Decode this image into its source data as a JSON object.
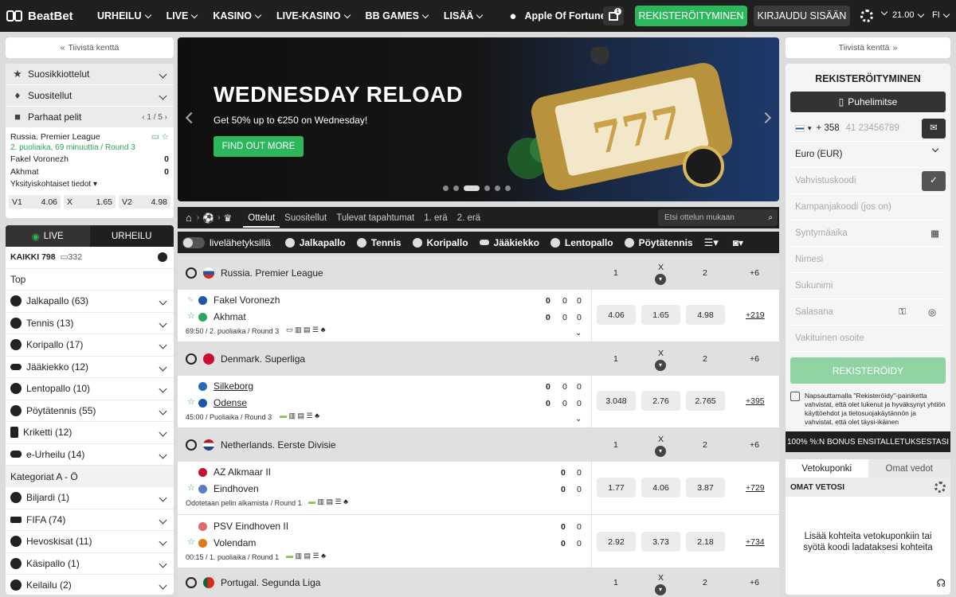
{
  "header": {
    "brand": "BeatBet",
    "nav": [
      "URHEILU",
      "LIVE",
      "KASINO",
      "LIVE-KASINO",
      "BB GAMES",
      "LISÄÄ"
    ],
    "apple_game": "Apple Of Fortune",
    "gift_count": "1",
    "register": "REKISTERÖITYMINEN",
    "login": "KIRJAUDU SISÄÄN",
    "time": "21.00",
    "lang": "FI"
  },
  "left": {
    "collapse": "Tiivistä kenttä",
    "favorites": "Suosikkiottelut",
    "recommended": "Suositellut",
    "best_games": "Parhaat pelit",
    "best_pager": "1 / 5",
    "best_match": {
      "league": "Russia. Premier League",
      "status": "2. puoliaika, 69 minuuttia / Round 3",
      "home": "Fakel Voronezh",
      "home_score": "0",
      "away": "Akhmat",
      "away_score": "0",
      "details": "Yksityiskohtaiset tiedot",
      "odds": [
        {
          "l": "V1",
          "v": "4.06"
        },
        {
          "l": "X",
          "v": "1.65"
        },
        {
          "l": "V2",
          "v": "4.98"
        }
      ]
    },
    "tab_live": "LIVE",
    "tab_sport": "URHEILU",
    "all_label": "KAIKKI 798",
    "all_stream": "332",
    "top": "Top",
    "sports": [
      "Jalkapallo (63)",
      "Tennis (13)",
      "Koripallo (17)",
      "Jääkiekko (12)",
      "Lentopallo (10)",
      "Pöytätennis (55)",
      "Kriketti (12)",
      "e-Urheilu (14)"
    ],
    "categories": "Kategoriat A - Ö",
    "cats": [
      "Biljardi (1)",
      "FIFA (74)",
      "Hevoskisat (11)",
      "Käsipallo (1)",
      "Keilailu (2)"
    ]
  },
  "banner": {
    "title": "WEDNESDAY RELOAD",
    "subtitle": "Get 50% up to €250 on Wednesday!",
    "cta": "FIND OUT MORE"
  },
  "main": {
    "tabs": [
      "Ottelut",
      "Suositellut",
      "Tulevat tapahtumat",
      "1. erä",
      "2. erä"
    ],
    "search": "Etsi ottelun mukaan",
    "live_toggle": "livelähetyksillä",
    "filters": [
      "Jalkapallo",
      "Tennis",
      "Koripallo",
      "Jääkiekko",
      "Lentopallo",
      "Pöytätennis"
    ],
    "leagues": [
      {
        "name": "Russia. Premier League",
        "c1": "1",
        "cx": "X",
        "c2": "2",
        "cp": "+6",
        "flag": "#d52b1e"
      },
      {
        "name": "Denmark. Superliga",
        "c1": "1",
        "cx": "X",
        "c2": "2",
        "cp": "+6",
        "flag": "#c8102e"
      },
      {
        "name": "Netherlands. Eerste Divisie",
        "c1": "1",
        "cx": "X",
        "c2": "2",
        "cp": "+6",
        "flag": "#ae1c28"
      },
      {
        "name": "Portugal. Segunda Liga",
        "c1": "1",
        "cx": "X",
        "c2": "2",
        "cp": "+6",
        "flag": "#046a38"
      }
    ],
    "matches": [
      {
        "home": "Fakel Voronezh",
        "away": "Akhmat",
        "hs": [
          "0",
          "0",
          "0"
        ],
        "as": [
          "0",
          "0",
          "0"
        ],
        "info": "69:50 / 2. puoliaika / Round 3",
        "o1": "4.06",
        "ox": "1.65",
        "o2": "4.98",
        "more": "+219"
      },
      {
        "home": "Silkeborg",
        "away": "Odense",
        "hs": [
          "0",
          "0",
          "0"
        ],
        "as": [
          "0",
          "0",
          "0"
        ],
        "info": "45:00 / Puoliaika / Round 3",
        "o1": "3.048",
        "ox": "2.76",
        "o2": "2.765",
        "more": "+395"
      },
      {
        "home": "AZ Alkmaar II",
        "away": "Eindhoven",
        "hs": [
          "0",
          "0"
        ],
        "as": [
          "0",
          "0"
        ],
        "info": "Odotetaan pelin alkamista / Round 1",
        "o1": "1.77",
        "ox": "4.06",
        "o2": "3.87",
        "more": "+729"
      },
      {
        "home": "PSV Eindhoven II",
        "away": "Volendam",
        "hs": [
          "0",
          "0"
        ],
        "as": [
          "0",
          "0"
        ],
        "info": "00:15 / 1. puoliaika / Round 1",
        "o1": "2.92",
        "ox": "3.73",
        "o2": "2.18",
        "more": "+734"
      }
    ]
  },
  "right": {
    "collapse": "Tiivistä kenttä",
    "title": "REKISTERÖITYMINEN",
    "phone_tab": "Puhelimitse",
    "phone_code": "+ 358",
    "phone_placeholder": "41 23456789",
    "currency": "Euro (EUR)",
    "fields": [
      "Vahvistuskoodi",
      "Kampanjakoodi (jos on)",
      "Syntymäaika",
      "Nimesi",
      "Sukunimi",
      "Salasana",
      "Vakituinen osoite"
    ],
    "submit": "REKISTERÖIDY",
    "terms": "Napsauttamalla \"Rekisteröidy\"-painiketta vahvistat, että olet lukenut ja hyväksynyt yhtiön käyttöehdot ja tietosuojakäytännön ja vahvistat, että olet täysi-ikäinen",
    "bonus": "100% %:N BONUS ENSITALLETUKSESTASI",
    "slip_tab1": "Vetokuponki",
    "slip_tab2": "Omat vedot",
    "slip_sub": "OMAT VETOSI",
    "slip_msg": "Lisää kohteita vetokuponkiin tai syötä koodi ladataksesi kohteita"
  }
}
